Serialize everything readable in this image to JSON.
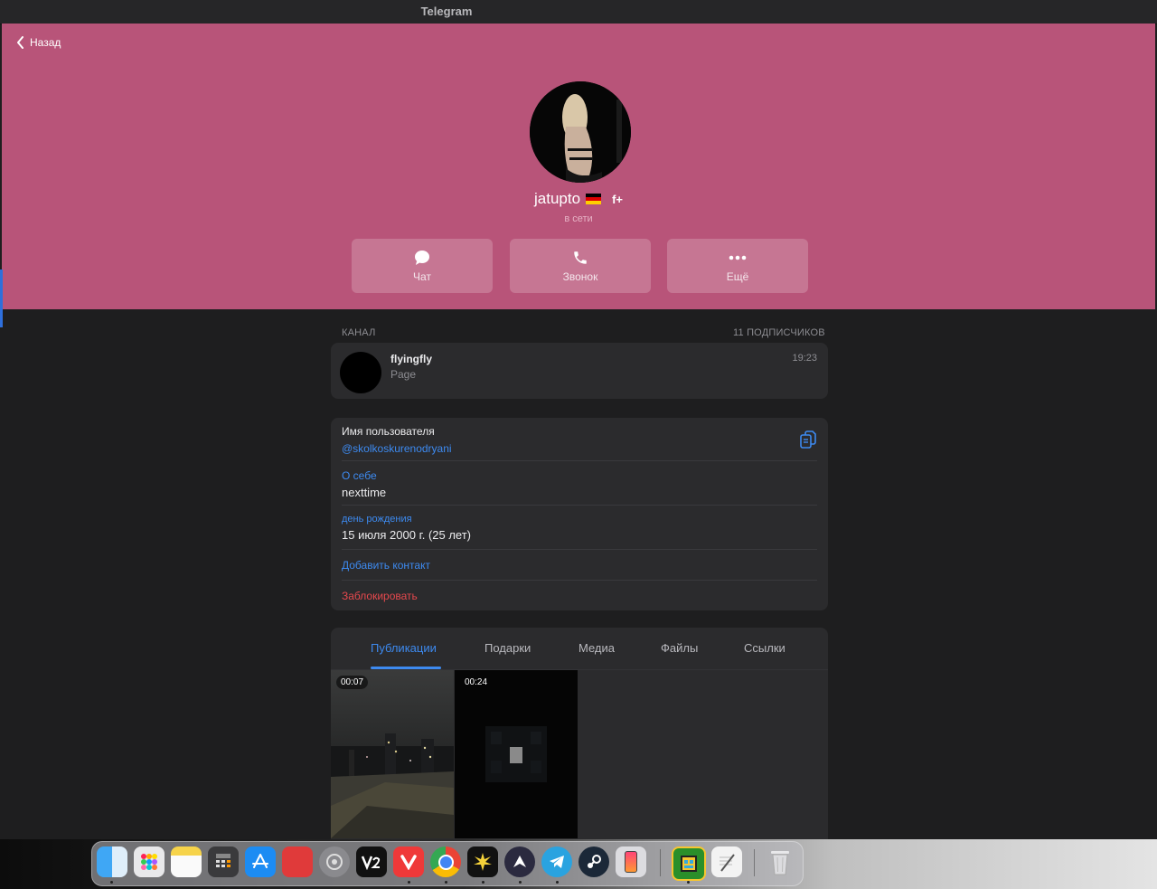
{
  "window": {
    "title": "Telegram"
  },
  "header": {
    "back_label": "Назад",
    "name": "jatupto",
    "badge": "f+",
    "status": "в сети",
    "actions": [
      {
        "label": "Чат",
        "icon": "chat-bubble-icon"
      },
      {
        "label": "Звонок",
        "icon": "phone-icon"
      },
      {
        "label": "Ещё",
        "icon": "more-dots-icon"
      }
    ],
    "colors": {
      "background": "#b85479",
      "accent": "#3d8af0"
    }
  },
  "channel": {
    "section_label": "КАНАЛ",
    "subscribers": "11 ПОДПИСЧИКОВ",
    "name": "flyingfly",
    "subtitle": "Page",
    "time": "19:23"
  },
  "info": {
    "username_label": "Имя пользователя",
    "username": "@skolkoskurenodryani",
    "about_label": "О себе",
    "about": "nexttime",
    "birthday_label": "день рождения",
    "birthday": "15 июля 2000 г. (25 лет)",
    "add_contact": "Добавить контакт",
    "block": "Заблокировать"
  },
  "tabs": {
    "items": [
      "Публикации",
      "Подарки",
      "Медиа",
      "Файлы",
      "Ссылки"
    ],
    "active": "Публикации"
  },
  "media": [
    {
      "duration": "00:07"
    },
    {
      "duration": "00:24"
    }
  ],
  "dock": {
    "apps": [
      "finder-icon",
      "launchpad-icon",
      "notes-icon",
      "calculator-icon",
      "app-store-icon",
      "photo-booth-icon",
      "system-settings-icon",
      "v2-app-icon",
      "vivaldi-icon",
      "chrome-icon",
      "burst-app-icon",
      "proton-vpn-icon",
      "telegram-icon",
      "steam-icon",
      "iphone-mirroring-icon",
      "geometry-dash-icon",
      "textedit-icon",
      "trash-icon"
    ]
  }
}
